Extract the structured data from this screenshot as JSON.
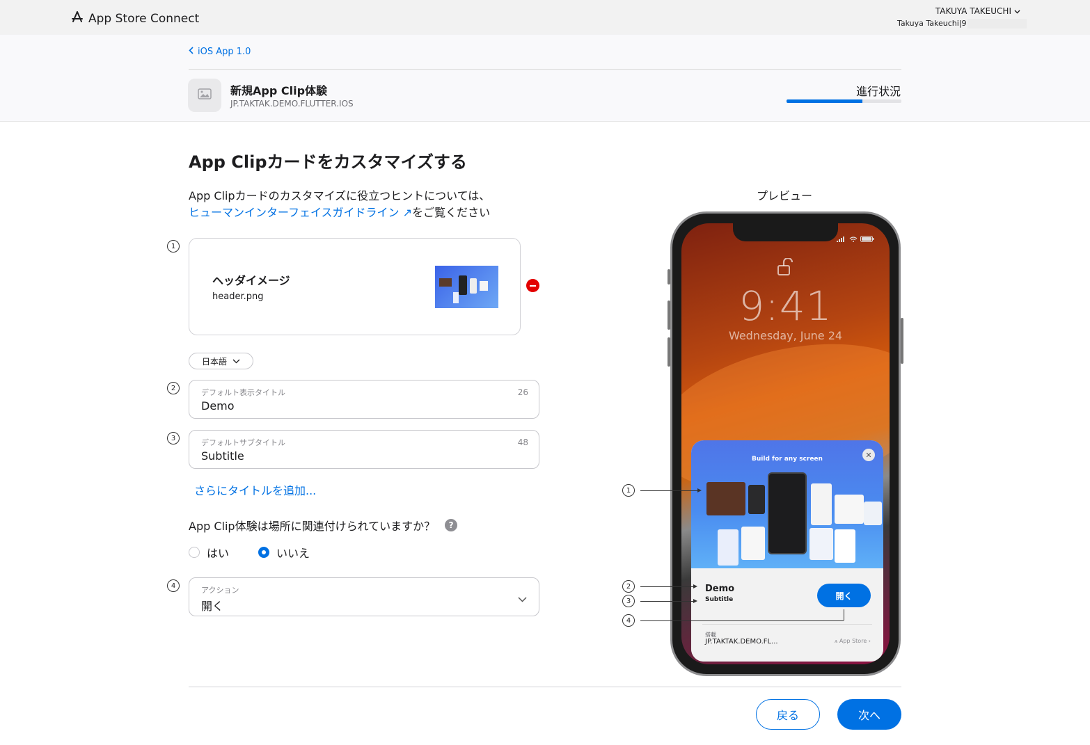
{
  "topbar": {
    "brand": "App Store Connect",
    "user_name": "TAKUYA TAKEUCHI",
    "user_sub": "Takuya Takeuchi|9"
  },
  "header": {
    "back_label": "iOS App 1.0",
    "app_title": "新規App Clip体験",
    "bundle_id": "JP.TAKTAK.DEMO.FLUTTER.IOS",
    "progress_label": "進行状況",
    "progress_fraction": 0.66
  },
  "main": {
    "title": "App Clipカードをカスタマイズする",
    "hint_prefix": "App Clipカードのカスタマイズに役立つヒントについては、",
    "hint_link": "ヒューマンインターフェイスガイドライン ↗",
    "hint_suffix": "をご覧ください",
    "header_image": {
      "step": "1",
      "label": "ヘッダイメージ",
      "filename": "header.png"
    },
    "language": "日本語",
    "title_field": {
      "step": "2",
      "label": "デフォルト表示タイトル",
      "value": "Demo",
      "remaining": "26"
    },
    "subtitle_field": {
      "step": "3",
      "label": "デフォルトサブタイトル",
      "value": "Subtitle",
      "remaining": "48"
    },
    "add_title_link": "さらにタイトルを追加...",
    "location_question": "App Clip体験は場所に関連付けられていますか？",
    "help_glyph": "?",
    "radio_yes": "はい",
    "radio_no": "いいえ",
    "radio_selected": "no",
    "action_field": {
      "step": "4",
      "label": "アクション",
      "value": "開く"
    }
  },
  "footer": {
    "back_button": "戻る",
    "next_button": "次へ"
  },
  "preview": {
    "label": "プレビュー",
    "time": "9:41",
    "date": "Wednesday, June 24",
    "hero_title": "Build for any screen",
    "close_glyph": "✕",
    "clip_title": "Demo",
    "clip_subtitle": "Subtitle",
    "open_button": "開く",
    "from_label": "搭載",
    "from_value": "JP.TAKTAK.DEMO.FL...",
    "store_link": "App Store",
    "annotations": [
      "1",
      "2",
      "3",
      "4"
    ]
  },
  "icons": {
    "brand": "app-store-icon",
    "back": "chevron-left-icon",
    "app": "image-placeholder-icon",
    "remove": "minus-circle-icon",
    "lang": "chevron-down-icon",
    "action": "chevron-down-icon"
  },
  "colors": {
    "accent": "#0071e3",
    "remove": "#e30000"
  }
}
